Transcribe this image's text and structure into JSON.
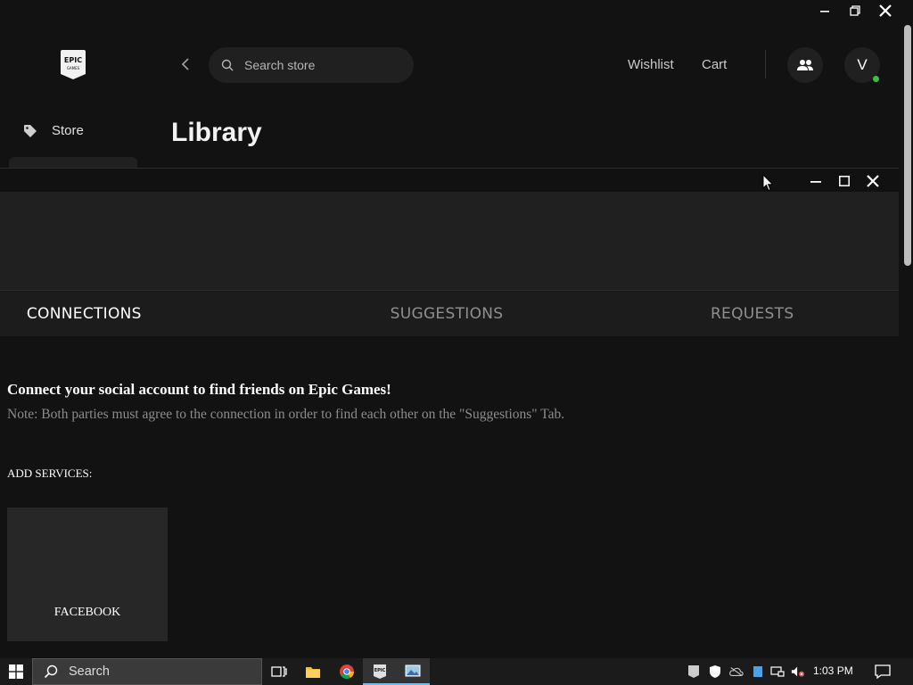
{
  "header": {
    "search_placeholder": "Search store",
    "wishlist": "Wishlist",
    "cart": "Cart",
    "avatar_initial": "V"
  },
  "sidebar": {
    "store": "Store"
  },
  "page": {
    "title": "Library"
  },
  "friends": {
    "tabs": [
      {
        "label": "CONNECTIONS",
        "active": true
      },
      {
        "label": "SUGGESTIONS",
        "active": false
      },
      {
        "label": "REQUESTS",
        "active": false
      }
    ],
    "connect_heading": "Connect your social account to find friends on Epic Games!",
    "connect_note": "Note: Both parties must agree to the connection in order to find each other on the \"Suggestions\" Tab.",
    "add_services": "ADD SERVICES:",
    "services": [
      {
        "label": "FACEBOOK"
      }
    ]
  },
  "taskbar": {
    "search": "Search",
    "time": "1:03 PM"
  },
  "colors": {
    "background": "#121212",
    "panel": "#202020",
    "online": "#3fbf3f",
    "taskbar_accent": "#76b9ed"
  }
}
